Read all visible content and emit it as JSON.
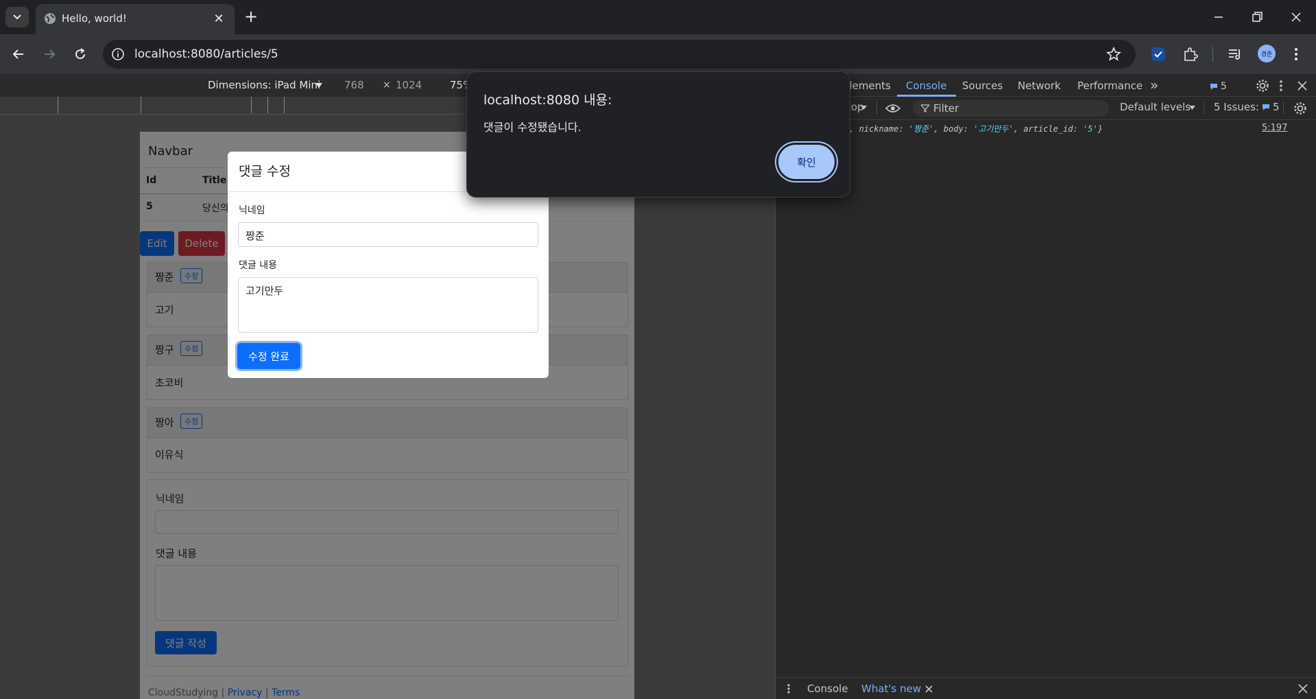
{
  "browser": {
    "tab_title": "Hello, world!",
    "url": "localhost:8080/articles/5",
    "profile_initials": "경준"
  },
  "device_toolbar": {
    "dimensions_label": "Dimensions: iPad Mini",
    "width": "768",
    "times": "×",
    "height": "1024",
    "zoom": "75%"
  },
  "page": {
    "navbar": "Navbar",
    "table_headers": [
      "Id",
      "Title"
    ],
    "row": {
      "id": "5",
      "title": "당신의"
    },
    "edit_label": "Edit",
    "delete_label": "Delete",
    "comments": [
      {
        "nickname": "짱준",
        "edit": "수정",
        "body": "고기"
      },
      {
        "nickname": "짱구",
        "edit": "수정",
        "body": "초코비"
      },
      {
        "nickname": "짱아",
        "edit": "수정",
        "body": "이유식"
      }
    ],
    "form": {
      "nickname_label": "닉네임",
      "body_label": "댓글 내용",
      "submit_label": "댓글 작성"
    },
    "footer": {
      "brand": "CloudStudying",
      "sep": "|",
      "privacy": "Privacy",
      "terms": "Terms"
    }
  },
  "modal": {
    "title": "댓글 수정",
    "nickname_label": "닉네임",
    "nickname_value": "짱준",
    "body_label": "댓글 내용",
    "body_value": "고기만두",
    "submit_label": "수정 완료"
  },
  "alert": {
    "title": "localhost:8080 내용:",
    "message": "댓글이 수정됐습니다.",
    "ok_label": "확인"
  },
  "devtools": {
    "tabs": [
      "Elements",
      "Console",
      "Sources",
      "Network",
      "Performance"
    ],
    "more_tabs": "»",
    "issues_count_badge": "5",
    "context_selector": "top",
    "filter_placeholder": "Filter",
    "levels": "Default levels",
    "issues_label": "5 Issues:",
    "issues_count": "5",
    "log_parts": {
      "prefix": "', nickname: ",
      "nickname": "'짱준'",
      "mid": ", body: ",
      "body": "'고기만두'",
      "mid2": ", article_id: ",
      "article_id": "'5'",
      "suffix": "}"
    },
    "log_source": "5:197",
    "drawer_tabs": [
      "Console",
      "What's new"
    ]
  },
  "colors": {
    "accent": "#0d6efd",
    "danger": "#dc3545",
    "devtools_accent": "#7cacf8",
    "alert_button": "#a8c7fa"
  }
}
